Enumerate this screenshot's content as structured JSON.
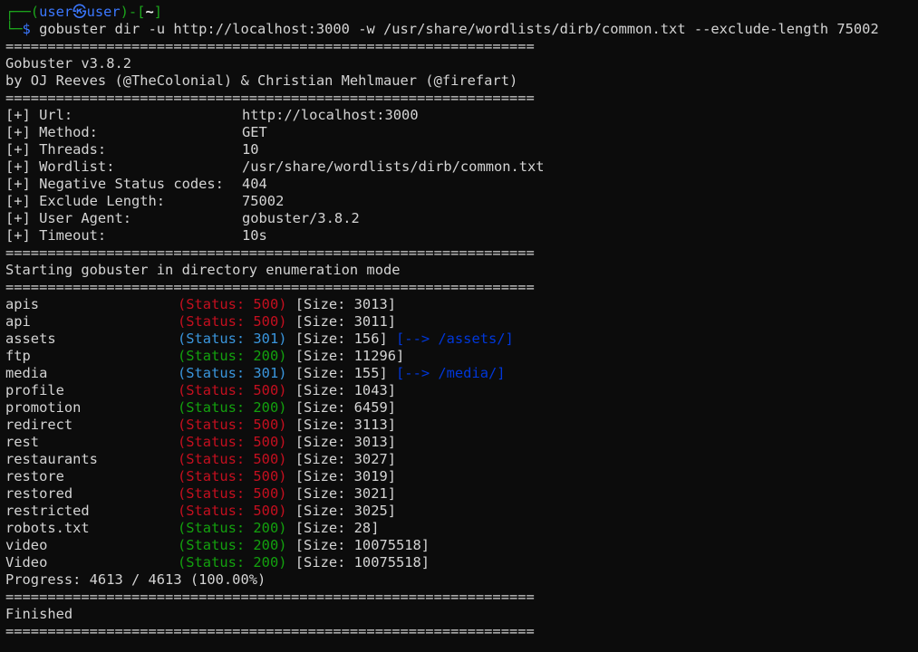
{
  "prompt": {
    "user": "user",
    "separator": "㉿",
    "host": "user",
    "cwd": "~",
    "symbol": "$",
    "command": "gobuster dir -u http://localhost:3000 -w /usr/share/wordlists/dirb/common.txt --exclude-length 75002"
  },
  "divider": "===============================================================",
  "banner": {
    "version": "Gobuster v3.8.2",
    "authors": "by OJ Reeves (@TheColonial) & Christian Mehlmauer (@firefart)"
  },
  "config": [
    {
      "label": "[+] Url:",
      "value": "http://localhost:3000"
    },
    {
      "label": "[+] Method:",
      "value": "GET"
    },
    {
      "label": "[+] Threads:",
      "value": "10"
    },
    {
      "label": "[+] Wordlist:",
      "value": "/usr/share/wordlists/dirb/common.txt"
    },
    {
      "label": "[+] Negative Status codes:",
      "value": "404"
    },
    {
      "label": "[+] Exclude Length:",
      "value": "75002"
    },
    {
      "label": "[+] User Agent:",
      "value": "gobuster/3.8.2"
    },
    {
      "label": "[+] Timeout:",
      "value": "10s"
    }
  ],
  "start_message": "Starting gobuster in directory enumeration mode",
  "results": [
    {
      "path": "apis",
      "status": "500",
      "size": "3013",
      "redirect": ""
    },
    {
      "path": "api",
      "status": "500",
      "size": "3011",
      "redirect": ""
    },
    {
      "path": "assets",
      "status": "301",
      "size": "156",
      "redirect": "/assets/"
    },
    {
      "path": "ftp",
      "status": "200",
      "size": "11296",
      "redirect": ""
    },
    {
      "path": "media",
      "status": "301",
      "size": "155",
      "redirect": "/media/"
    },
    {
      "path": "profile",
      "status": "500",
      "size": "1043",
      "redirect": ""
    },
    {
      "path": "promotion",
      "status": "200",
      "size": "6459",
      "redirect": ""
    },
    {
      "path": "redirect",
      "status": "500",
      "size": "3113",
      "redirect": ""
    },
    {
      "path": "rest",
      "status": "500",
      "size": "3013",
      "redirect": ""
    },
    {
      "path": "restaurants",
      "status": "500",
      "size": "3027",
      "redirect": ""
    },
    {
      "path": "restore",
      "status": "500",
      "size": "3019",
      "redirect": ""
    },
    {
      "path": "restored",
      "status": "500",
      "size": "3021",
      "redirect": ""
    },
    {
      "path": "restricted",
      "status": "500",
      "size": "3025",
      "redirect": ""
    },
    {
      "path": "robots.txt",
      "status": "200",
      "size": "28",
      "redirect": ""
    },
    {
      "path": "video",
      "status": "200",
      "size": "10075518",
      "redirect": ""
    },
    {
      "path": "Video",
      "status": "200",
      "size": "10075518",
      "redirect": ""
    }
  ],
  "progress": "Progress: 4613 / 4613 (100.00%)",
  "finished": "Finished",
  "colors": {
    "background": "#0c0c0c",
    "text": "#d4d4d4",
    "status_500": "#c50f1f",
    "status_200": "#13a10e",
    "status_301": "#3a96dd",
    "redirect": "#0037da",
    "prompt_green": "#1ca51c",
    "prompt_blue": "#3b78ff"
  }
}
